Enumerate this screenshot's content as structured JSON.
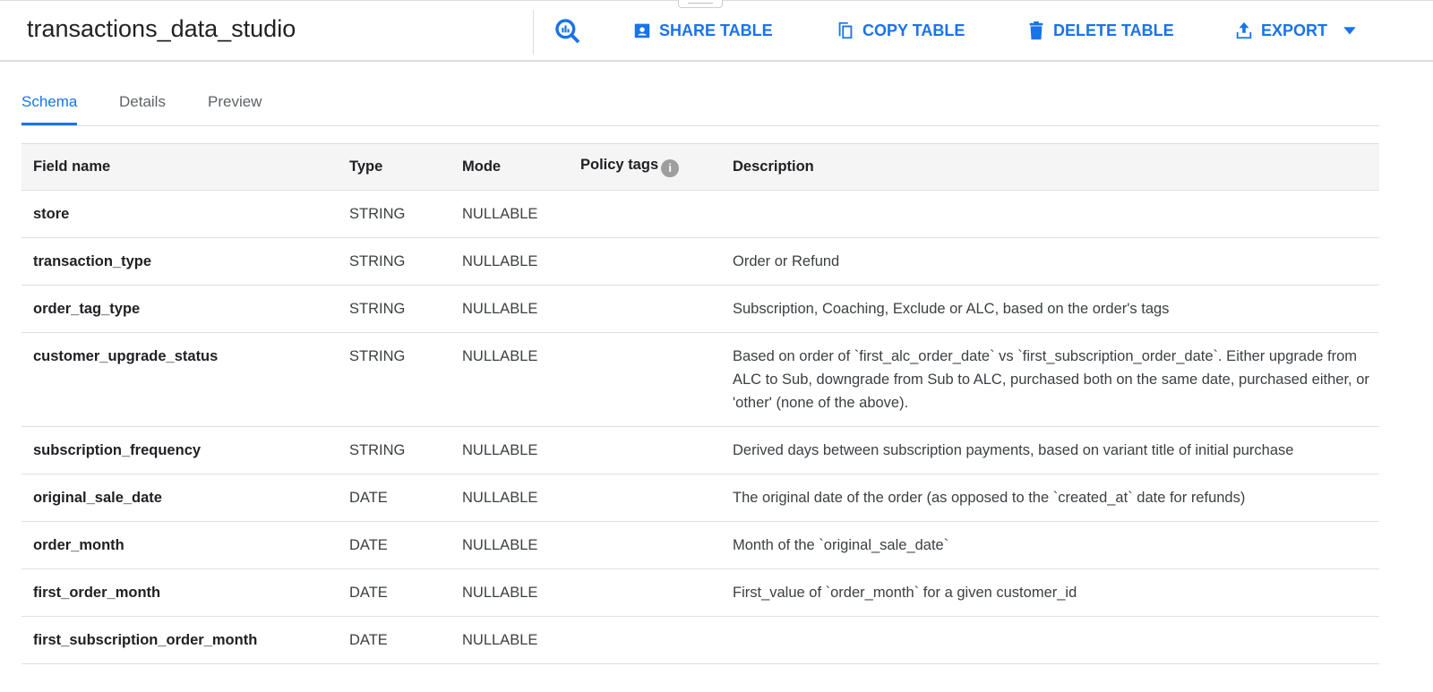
{
  "header": {
    "title": "transactions_data_studio",
    "share": "SHARE TABLE",
    "copy": "COPY TABLE",
    "delete": "DELETE TABLE",
    "export": "EXPORT"
  },
  "tabs": [
    "Schema",
    "Details",
    "Preview"
  ],
  "columns": [
    "Field name",
    "Type",
    "Mode",
    "Policy tags",
    "Description"
  ],
  "rows": [
    {
      "name": "store",
      "type": "STRING",
      "mode": "NULLABLE",
      "desc": ""
    },
    {
      "name": "transaction_type",
      "type": "STRING",
      "mode": "NULLABLE",
      "desc": "Order or Refund"
    },
    {
      "name": "order_tag_type",
      "type": "STRING",
      "mode": "NULLABLE",
      "desc": "Subscription, Coaching, Exclude or ALC, based on the order's tags"
    },
    {
      "name": "customer_upgrade_status",
      "type": "STRING",
      "mode": "NULLABLE",
      "desc": "Based on order of `first_alc_order_date` vs `first_subscription_order_date`. Either upgrade from ALC to Sub, downgrade from Sub to ALC, purchased both on the same date, purchased either, or 'other' (none of the above)."
    },
    {
      "name": "subscription_frequency",
      "type": "STRING",
      "mode": "NULLABLE",
      "desc": "Derived days between subscription payments, based on variant title of initial purchase"
    },
    {
      "name": "original_sale_date",
      "type": "DATE",
      "mode": "NULLABLE",
      "desc": "The original date of the order (as opposed to the `created_at` date for refunds)"
    },
    {
      "name": "order_month",
      "type": "DATE",
      "mode": "NULLABLE",
      "desc": "Month of the `original_sale_date`"
    },
    {
      "name": "first_order_month",
      "type": "DATE",
      "mode": "NULLABLE",
      "desc": "First_value of `order_month` for a given customer_id"
    },
    {
      "name": "first_subscription_order_month",
      "type": "DATE",
      "mode": "NULLABLE",
      "desc": ""
    }
  ]
}
